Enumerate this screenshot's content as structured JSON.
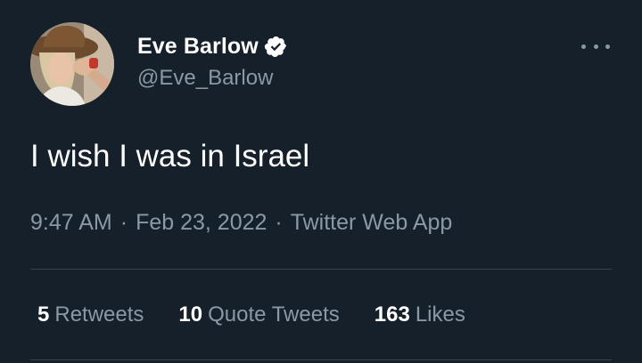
{
  "user": {
    "display_name": "Eve Barlow",
    "handle": "@Eve_Barlow",
    "verified": true
  },
  "tweet": {
    "text": "I wish I was in Israel",
    "time": "9:47 AM",
    "date": "Feb 23, 2022",
    "separator": "·",
    "source": "Twitter Web App"
  },
  "stats": {
    "retweets": {
      "count": "5",
      "label": "Retweets"
    },
    "quote_tweets": {
      "count": "10",
      "label": "Quote Tweets"
    },
    "likes": {
      "count": "163",
      "label": "Likes"
    }
  },
  "icons": {
    "verified": "verified-badge-icon",
    "more": "more-options-icon"
  },
  "colors": {
    "background": "#15202b",
    "primary_text": "#ffffff",
    "secondary_text": "#8b98a5",
    "divider": "#38444d"
  }
}
